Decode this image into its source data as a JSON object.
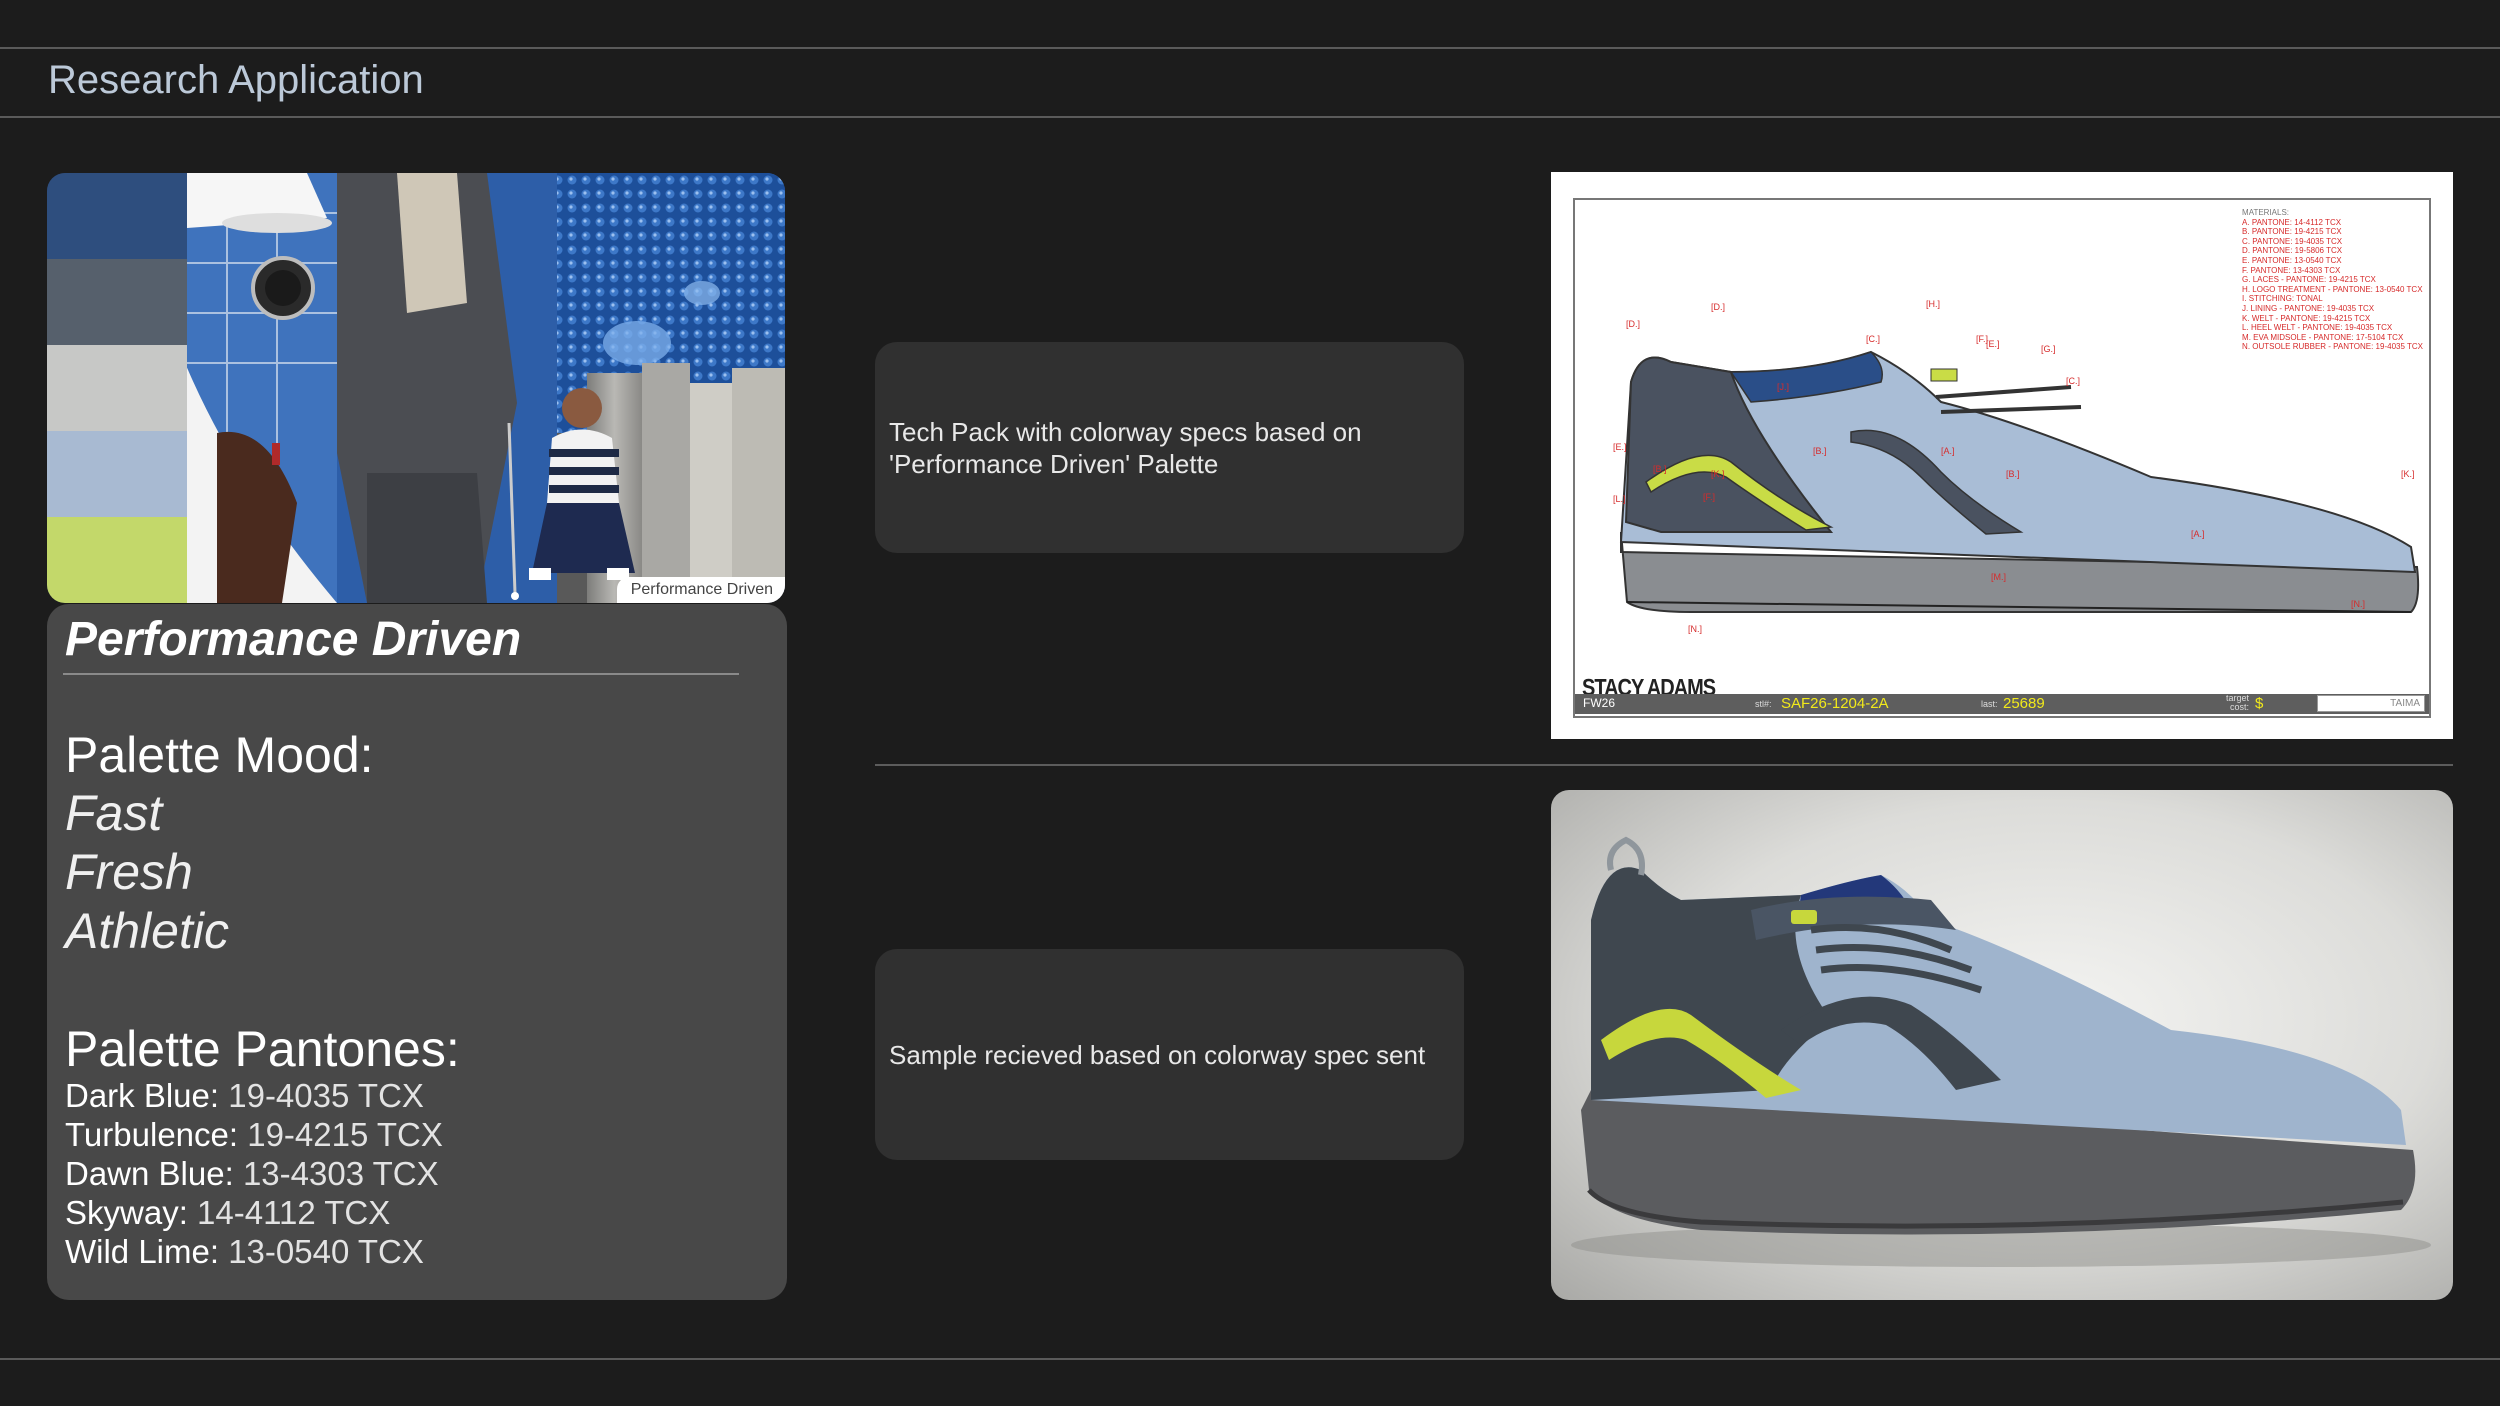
{
  "page": {
    "title": "Research Application"
  },
  "moodboard": {
    "caption": "Performance Driven",
    "swatch_colors": [
      "#2e4e7e",
      "#56606c",
      "#c7c8c6",
      "#a8bad2",
      "#c3d86a"
    ]
  },
  "palette": {
    "name": "Performance Driven",
    "mood_heading": "Palette Mood:",
    "mood_words": [
      "Fast",
      "Fresh",
      "Athletic"
    ],
    "pantones_heading": "Palette Pantones:",
    "pantones": [
      {
        "name": "Dark Blue:",
        "code": "19-4035 TCX"
      },
      {
        "name": "Turbulence:",
        "code": "19-4215 TCX"
      },
      {
        "name": "Dawn Blue:",
        "code": "13-4303 TCX"
      },
      {
        "name": "Skyway:",
        "code": "14-4112 TCX"
      },
      {
        "name": "Wild Lime:",
        "code": "13-0540 TCX"
      }
    ]
  },
  "cards": {
    "techpack_text": "Tech Pack with colorway specs based on 'Performance Driven' Palette",
    "sample_text": "Sample recieved based on colorway spec sent"
  },
  "techpack": {
    "materials_heading": "MATERIALS:",
    "materials": [
      "A.  PANTONE: 14-4112 TCX",
      "B.  PANTONE: 19-4215 TCX",
      "C.  PANTONE: 19-4035 TCX",
      "D.  PANTONE: 19-5806 TCX",
      "E.  PANTONE: 13-0540 TCX",
      "F.  PANTONE: 13-4303 TCX",
      "G.  LACES - PANTONE: 19-4215 TCX",
      "H.  LOGO TREATMENT - PANTONE: 13-0540 TCX",
      "I.  STITCHING: TONAL",
      "J.  LINING - PANTONE: 19-4035 TCX",
      "K.  WELT - PANTONE: 19-4215 TCX",
      "L.  HEEL WELT - PANTONE: 19-4035 TCX",
      "M.  EVA MIDSOLE - PANTONE: 17-5104 TCX",
      "N.  OUTSOLE RUBBER - PANTONE: 19-4035 TCX"
    ],
    "brand": "STACY ADAMS",
    "season": "FW26",
    "style_label": "stl#:",
    "style_value": "SAF26-1204-2A",
    "last_label": "last:",
    "last_value": "25689",
    "target_label": "target cost:",
    "target_value": "$",
    "factory": "TAIMA",
    "callouts": [
      "[D.]",
      "[H.]",
      "[F.]",
      "[C.]",
      "[E.]",
      "[G.]",
      "[D.]",
      "[J.]",
      "[C.]",
      "[E.]",
      "[B.]",
      "[A.]",
      "[B.]",
      "[L.]",
      "[K.]",
      "[F.]",
      "[B.]",
      "[A.]",
      "[M.]",
      "[K.]",
      "[N.]",
      "[N.]"
    ]
  }
}
